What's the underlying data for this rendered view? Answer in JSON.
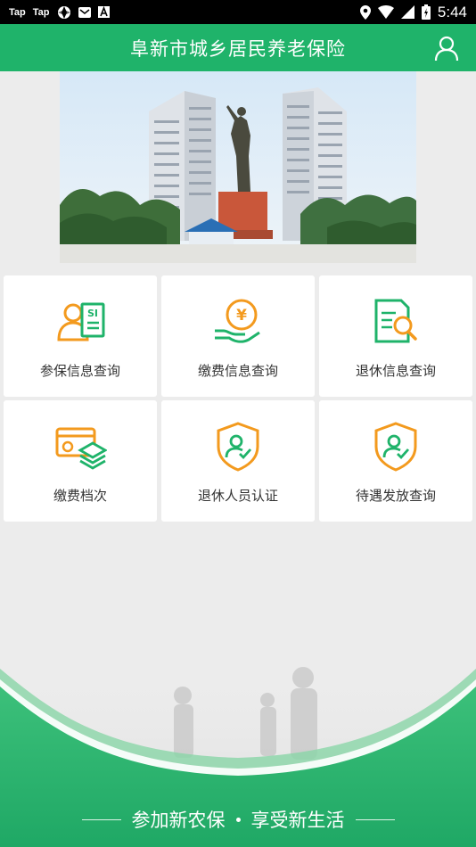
{
  "status_bar": {
    "left_items": [
      "Tap",
      "Tap"
    ],
    "time": "5:44",
    "icons": [
      "tap-app-icon",
      "tap-app-icon",
      "aperture-icon",
      "mail-icon",
      "a-icon",
      "location-icon",
      "wifi-icon",
      "signal-icon",
      "battery-icon"
    ]
  },
  "header": {
    "title": "阜新市城乡居民养老保险",
    "user_icon": "user-icon"
  },
  "banner": {
    "description_icon": "statue-photo"
  },
  "menu": [
    {
      "label": "参保信息查询",
      "icon": "si-card-icon"
    },
    {
      "label": "缴费信息查询",
      "icon": "yen-hand-icon"
    },
    {
      "label": "退休信息查询",
      "icon": "document-search-icon"
    },
    {
      "label": "缴费档次",
      "icon": "card-stack-icon"
    },
    {
      "label": "退休人员认证",
      "icon": "shield-user-icon"
    },
    {
      "label": "待遇发放查询",
      "icon": "shield-user-check-icon"
    }
  ],
  "footer": {
    "slogan_left": "参加新农保",
    "slogan_right": "享受新生活"
  },
  "colors": {
    "primary_green": "#1fb36a",
    "accent_orange": "#f39a1e"
  }
}
